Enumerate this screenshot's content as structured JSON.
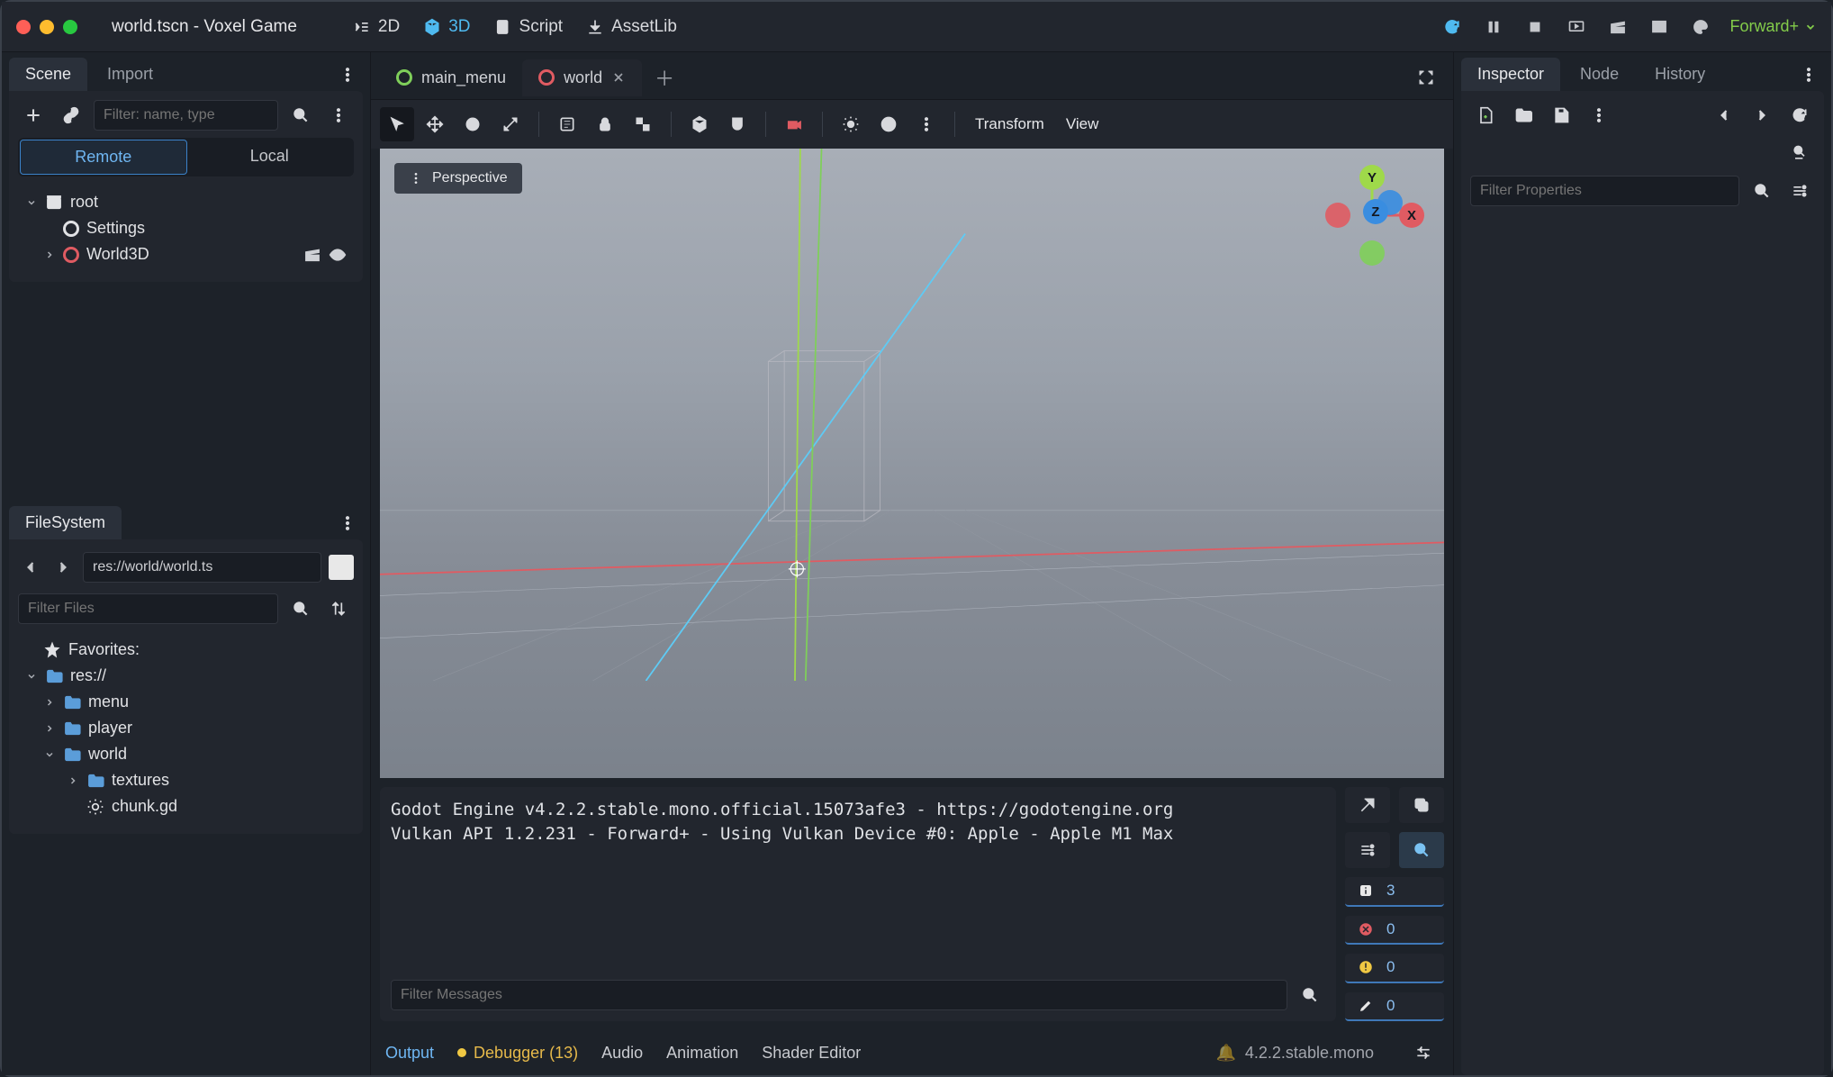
{
  "window": {
    "title": "world.tscn - Voxel Game"
  },
  "workspace": {
    "tabs": [
      "2D",
      "3D",
      "Script",
      "AssetLib"
    ],
    "active": "3D"
  },
  "render_mode": "Forward+",
  "scene_dock": {
    "tabs": [
      "Scene",
      "Import"
    ],
    "active": "Scene",
    "filter_placeholder": "Filter: name, type",
    "mode_tabs": [
      "Remote",
      "Local"
    ],
    "mode_active": "Remote",
    "tree": [
      {
        "label": "root",
        "icon": "node",
        "level": 0,
        "expanded": true
      },
      {
        "label": "Settings",
        "icon": "circle-white",
        "level": 1
      },
      {
        "label": "World3D",
        "icon": "circle-red",
        "level": 1,
        "has_children": true,
        "actions": [
          "clapper",
          "eye"
        ]
      }
    ]
  },
  "filesystem": {
    "tab": "FileSystem",
    "path": "res://world/world.ts",
    "filter_placeholder": "Filter Files",
    "tree": [
      {
        "label": "Favorites:",
        "icon": "star",
        "level": 0
      },
      {
        "label": "res://",
        "icon": "folder",
        "level": 0,
        "expanded": true
      },
      {
        "label": "menu",
        "icon": "folder",
        "level": 1,
        "has_children": true
      },
      {
        "label": "player",
        "icon": "folder",
        "level": 1,
        "has_children": true
      },
      {
        "label": "world",
        "icon": "folder",
        "level": 1,
        "expanded": true
      },
      {
        "label": "textures",
        "icon": "folder",
        "level": 2,
        "has_children": true
      },
      {
        "label": "chunk.gd",
        "icon": "gear",
        "level": 2
      }
    ]
  },
  "scene_tabs": {
    "tabs": [
      {
        "label": "main_menu",
        "icon_color": "#7fcf5a"
      },
      {
        "label": "world",
        "icon_color": "#e05b62",
        "closable": true
      }
    ],
    "active": "world"
  },
  "viewport": {
    "perspective_label": "Perspective",
    "right_labels": [
      "Transform",
      "View"
    ]
  },
  "output": {
    "text": "Godot Engine v4.2.2.stable.mono.official.15073afe3 - https://godotengine.org\nVulkan API 1.2.231 - Forward+ - Using Vulkan Device #0: Apple - Apple M1 Max",
    "filter_placeholder": "Filter Messages",
    "counts": {
      "info": 3,
      "error": 0,
      "warning": 0,
      "edit": 0
    }
  },
  "bottom_tabs": {
    "items": [
      "Output",
      "Debugger (13)",
      "Audio",
      "Animation",
      "Shader Editor"
    ],
    "active": "Output",
    "version": "4.2.2.stable.mono"
  },
  "inspector": {
    "tabs": [
      "Inspector",
      "Node",
      "History"
    ],
    "active": "Inspector",
    "filter_placeholder": "Filter Properties"
  }
}
